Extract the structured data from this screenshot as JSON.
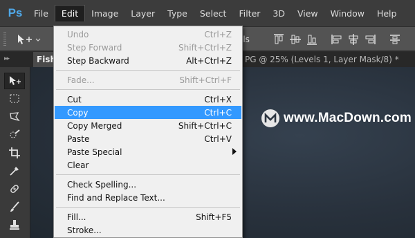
{
  "app": {
    "logo": "Ps"
  },
  "menubar": {
    "items": [
      "File",
      "Edit",
      "Image",
      "Layer",
      "Type",
      "Select",
      "Filter",
      "3D",
      "View",
      "Window",
      "Help"
    ],
    "active": "Edit"
  },
  "options_bar": {
    "partial_label": "ols"
  },
  "document": {
    "tab_label": "Fishi",
    "title_fragment": "PG @ 25% (Levels 1, Layer Mask/8) *"
  },
  "watermark": {
    "text": "www.MacDown.com"
  },
  "edit_menu": {
    "items": [
      {
        "label": "Undo",
        "shortcut": "Ctrl+Z",
        "disabled": true
      },
      {
        "label": "Step Forward",
        "shortcut": "Shift+Ctrl+Z",
        "disabled": true
      },
      {
        "label": "Step Backward",
        "shortcut": "Alt+Ctrl+Z"
      },
      {
        "label": "Fade...",
        "shortcut": "Shift+Ctrl+F",
        "disabled": true
      },
      {
        "label": "Cut",
        "shortcut": "Ctrl+X"
      },
      {
        "label": "Copy",
        "shortcut": "Ctrl+C",
        "highlighted": true
      },
      {
        "label": "Copy Merged",
        "shortcut": "Shift+Ctrl+C"
      },
      {
        "label": "Paste",
        "shortcut": "Ctrl+V"
      },
      {
        "label": "Paste Special",
        "shortcut": "",
        "submenu": true
      },
      {
        "label": "Clear",
        "shortcut": ""
      },
      {
        "label": "Check Spelling...",
        "shortcut": ""
      },
      {
        "label": "Find and Replace Text...",
        "shortcut": ""
      },
      {
        "label": "Fill...",
        "shortcut": "Shift+F5"
      },
      {
        "label": "Stroke...",
        "shortcut": ""
      }
    ]
  },
  "colors": {
    "highlight": "#3399ff",
    "menubar": "#3c3c3c",
    "menu_bg": "#f0f0f0",
    "ps_blue": "#4fa8e8"
  }
}
